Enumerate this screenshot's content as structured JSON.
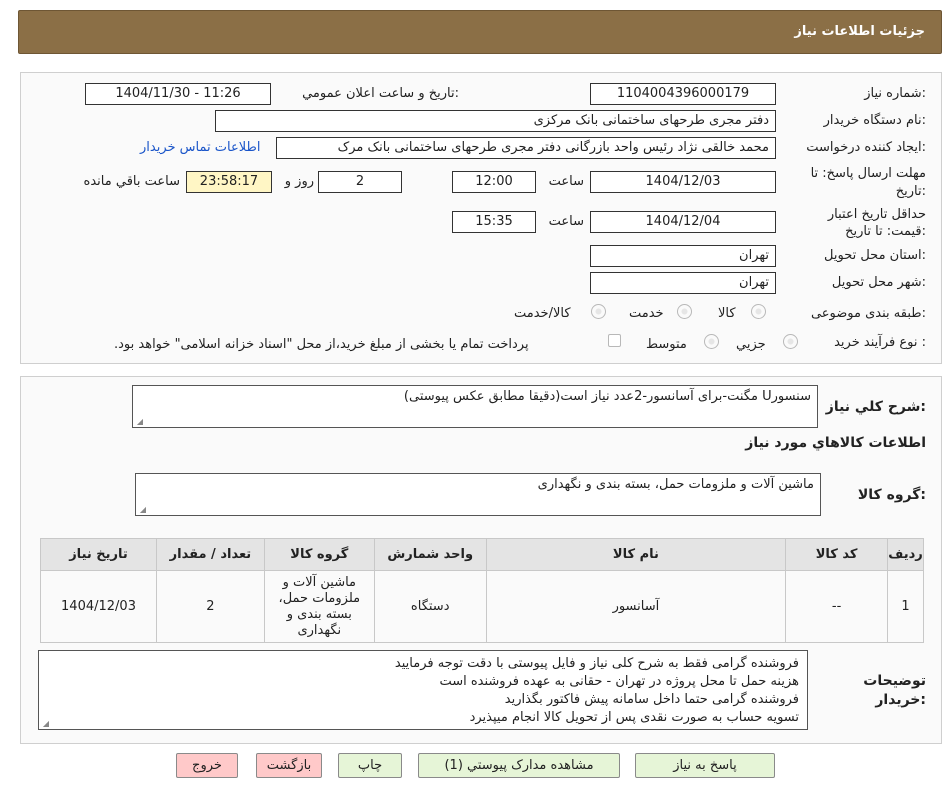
{
  "header": {
    "title": "جزئيات اطلاعات نياز"
  },
  "form": {
    "need_number_label": "شماره نياز:",
    "need_number": "1104004396000179",
    "announce_label": "تاريخ و ساعت اعلان عمومي:",
    "announce_value": "1404/11/30 - 11:26",
    "buyer_org_label": "نام دستگاه خريدار:",
    "buyer_org": "دفتر مجری طرحهای ساختمانی بانک مرکزی",
    "requester_label": "ايجاد کننده درخواست:",
    "requester": "محمد خالقی نژاد رئیس واحد بازرگانی دفتر مجری طرحهای ساختمانی بانک مرک",
    "contact_link": "اطلاعات تماس خريدار",
    "deadline_label_1": "مهلت ارسال پاسخ: تا",
    "deadline_label_2": "تاريخ:",
    "deadline_date": "1404/12/03",
    "time_label": "ساعت",
    "deadline_time": "12:00",
    "days_value": "2",
    "days_label": "روز و",
    "remaining_time": "23:58:17",
    "remaining_label": "ساعت باقي مانده",
    "validity_label_1": "حداقل تاريخ اعتبار",
    "validity_label_2": "قيمت: تا تاريخ:",
    "validity_date": "1404/12/04",
    "validity_time": "15:35",
    "province_label": "استان محل تحويل:",
    "province": "تهران",
    "city_label": "شهر محل تحويل:",
    "city": "تهران",
    "category_label": "طبقه بندی موضوعی:",
    "category_options": [
      "کالا",
      "خدمت",
      "کالا/خدمت"
    ],
    "process_label": "نوع فرآيند خريد :",
    "process_options": [
      "جزيي",
      "متوسط"
    ],
    "payment_note": "پرداخت تمام يا بخشی از مبلغ خريد،از محل \"اسناد خزانه اسلامی\" خواهد بود."
  },
  "summary": {
    "title_label": "شرح کلي نياز:",
    "title_text": "سنسورU مگنت-برای آسانسور-2عدد نیاز است(دقیقا مطابق عکس پیوستی)",
    "items_heading": "اطلاعات کالاهاي مورد نياز",
    "group_label": "گروه کالا:",
    "group_text": "ماشین آلات و ملزومات حمل، بسته بندی و نگهداری"
  },
  "table": {
    "headers": [
      "رديف",
      "کد کالا",
      "نام کالا",
      "واحد شمارش",
      "گروه کالا",
      "تعداد / مقدار",
      "تاريخ نياز"
    ],
    "row": {
      "index": "1",
      "code": "--",
      "name": "آسانسور",
      "unit": "دستگاه",
      "group": "ماشین آلات و ملزومات حمل، بسته بندی و نگهداری",
      "qty": "2",
      "date": "1404/12/03"
    }
  },
  "notes": {
    "label_1": "توضيحات",
    "label_2": "خريدار:",
    "lines": [
      "فروشنده گرامی فقط به شرح کلی نیاز و فایل پیوستی با دقت توجه فرمایید",
      "هزینه حمل تا محل پروژه در تهران - حقانی به عهده فروشنده است",
      "فروشنده گرامی حتما داخل سامانه پیش فاکتور بگذارید",
      "تسویه حساب به صورت نقدی پس از تحویل کالا  انجام میپذیرد"
    ]
  },
  "buttons": {
    "reply": "پاسخ به نياز",
    "attachments": "مشاهده مدارک پيوستي (1)",
    "print": "چاپ",
    "back": "بازگشت",
    "exit": "خروج"
  },
  "watermark": {
    "text": "AriaTender.neT"
  },
  "colors": {
    "header_bg": "#8b6f46",
    "link": "#1a55c9",
    "highlight": "#fff6c5",
    "green_btn": "#e6f5d7",
    "red_btn": "#ffc9c9"
  }
}
